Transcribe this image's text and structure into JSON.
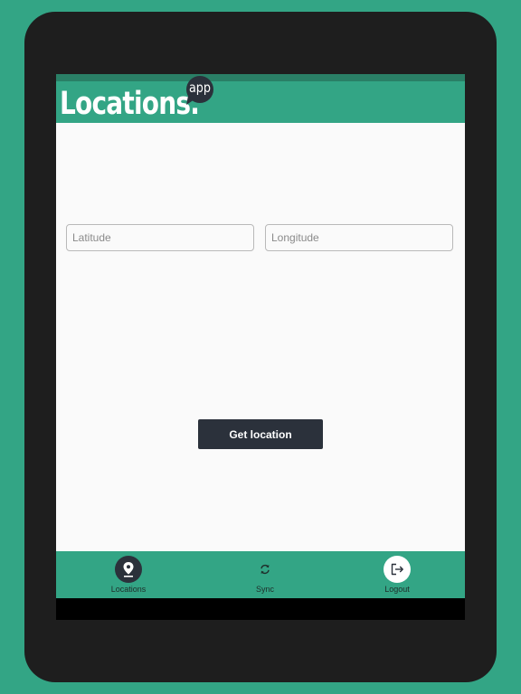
{
  "header": {
    "logo_text": "Locations.",
    "logo_badge": "app"
  },
  "form": {
    "latitude_placeholder": "Latitude",
    "longitude_placeholder": "Longitude",
    "latitude_value": "",
    "longitude_value": "",
    "get_location_label": "Get location"
  },
  "bottom_nav": {
    "items": [
      {
        "label": "Locations",
        "icon": "map-pin-icon",
        "active": true
      },
      {
        "label": "Sync",
        "icon": "sync-icon",
        "active": false
      },
      {
        "label": "Logout",
        "icon": "logout-icon",
        "active": false
      }
    ]
  },
  "colors": {
    "brand_green": "#33a585",
    "dark_button": "#2b313b",
    "device_frame": "#1e1e1e"
  }
}
